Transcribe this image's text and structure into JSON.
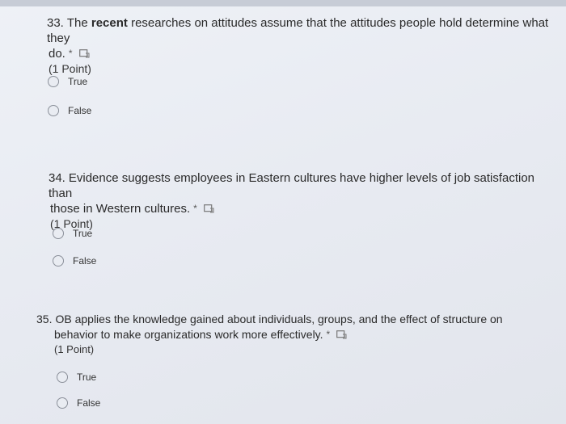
{
  "q33": {
    "number": "33.",
    "text_a": "The ",
    "text_bold": "recent",
    "text_b": " researches on attitudes assume that the attitudes people hold determine what they",
    "text_c": "do.",
    "required": "*",
    "points": "(1 Point)",
    "options": [
      "True",
      "False"
    ]
  },
  "q34": {
    "number": "34.",
    "text_a": "Evidence suggests employees in Eastern cultures have higher levels of job satisfaction than",
    "text_b": "those in Western cultures.",
    "required": "*",
    "points": "(1 Point)",
    "options": [
      "True",
      "False"
    ]
  },
  "q35": {
    "number": "35.",
    "text_a": "OB applies the knowledge gained about individuals, groups, and the effect of structure on",
    "text_b": "behavior to make organizations work more effectively.",
    "required": "*",
    "points": "(1 Point)",
    "options": [
      "True",
      "False"
    ]
  },
  "icons": {
    "immersive_reader": "immersive-reader-icon",
    "radio": "radio-button-icon"
  },
  "colors": {
    "background": "#e8ebf2",
    "text": "#2a2a2a",
    "radio_border": "#8a8f99"
  }
}
